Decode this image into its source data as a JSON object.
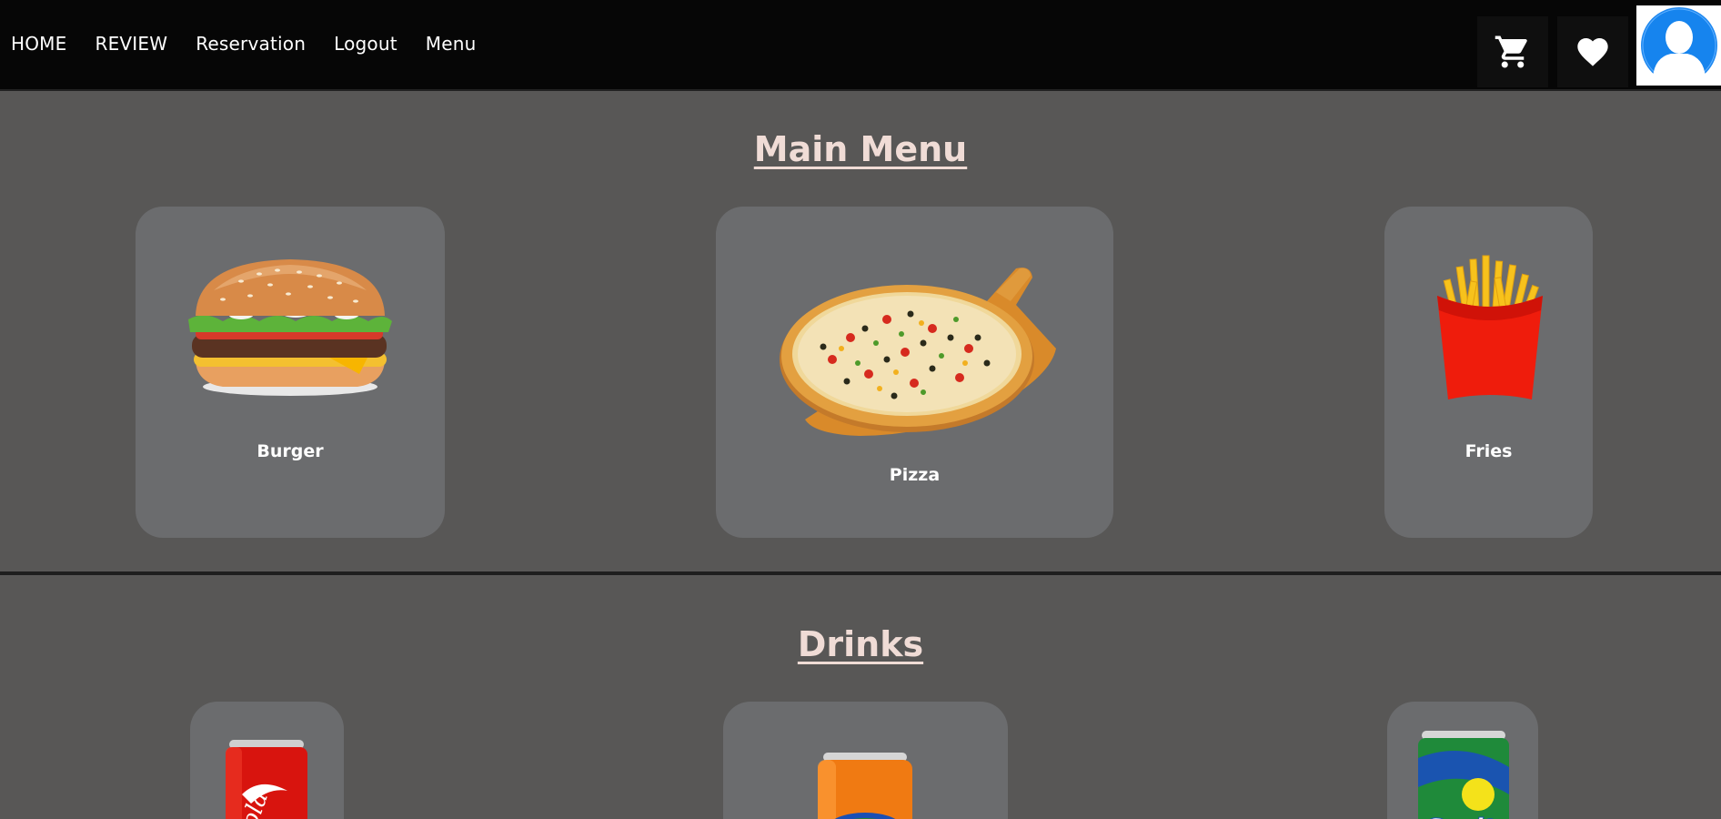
{
  "nav": {
    "links": [
      "HOME",
      "REVIEW",
      "Reservation",
      "Logout",
      "Menu"
    ],
    "cart_icon": "cart-icon",
    "heart_icon": "heart-icon",
    "avatar_icon": "user-avatar-icon"
  },
  "main_menu": {
    "title": "Main Menu",
    "items": [
      {
        "label": "Burger",
        "icon": "burger-image"
      },
      {
        "label": "Pizza",
        "icon": "pizza-image"
      },
      {
        "label": "Fries",
        "icon": "fries-image"
      }
    ]
  },
  "drinks": {
    "title": "Drinks",
    "items": [
      {
        "label": "",
        "icon": "cola-can-image"
      },
      {
        "label": "",
        "icon": "fanta-can-image"
      },
      {
        "label": "",
        "icon": "sprite-can-image"
      }
    ]
  },
  "colors": {
    "navbar_bg": "#060606",
    "page_bg": "#585756",
    "card_bg": "#6b6c6e",
    "title_color": "#f0dcd6",
    "avatar_blue": "#1e88f0"
  }
}
